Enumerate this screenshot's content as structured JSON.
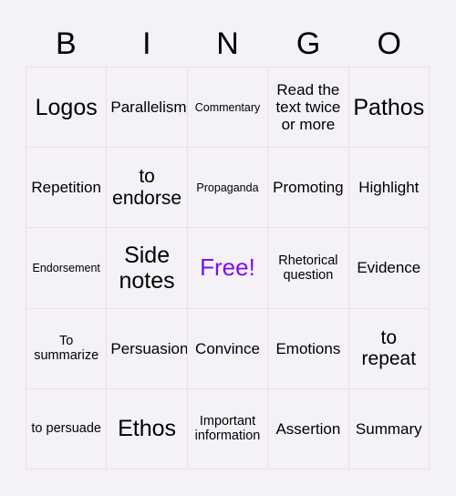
{
  "card": {
    "background_color": "#f4f2f6",
    "grid_line_color": "#ebdcf7",
    "text_color": "#000000",
    "free_space_color": "#7d0ff0"
  },
  "header": {
    "letters": [
      {
        "label": "B"
      },
      {
        "label": "I"
      },
      {
        "label": "N"
      },
      {
        "label": "G"
      },
      {
        "label": "O"
      }
    ]
  },
  "grid": {
    "columns": 5,
    "rows": 5,
    "cells": [
      {
        "text": "Logos",
        "size": "xl",
        "free": false
      },
      {
        "text": "Parallelism",
        "size": "md",
        "free": false
      },
      {
        "text": "Commentary",
        "size": "xs",
        "free": false
      },
      {
        "text": "Read the text twice or more",
        "size": "md",
        "free": false
      },
      {
        "text": "Pathos",
        "size": "xl",
        "free": false
      },
      {
        "text": "Repetition",
        "size": "md",
        "free": false
      },
      {
        "text": "to endorse",
        "size": "lg",
        "free": false
      },
      {
        "text": "Propaganda",
        "size": "xs",
        "free": false
      },
      {
        "text": "Promoting",
        "size": "md",
        "free": false
      },
      {
        "text": "Highlight",
        "size": "md",
        "free": false
      },
      {
        "text": "Endorsement",
        "size": "xs",
        "free": false
      },
      {
        "text": "Side notes",
        "size": "xl",
        "free": false
      },
      {
        "text": "Free!",
        "size": "xl",
        "free": true
      },
      {
        "text": "Rhetorical question",
        "size": "sm",
        "free": false
      },
      {
        "text": "Evidence",
        "size": "md",
        "free": false
      },
      {
        "text": "To summarize",
        "size": "sm",
        "free": false
      },
      {
        "text": "Persuasion",
        "size": "md",
        "free": false
      },
      {
        "text": "Convince",
        "size": "md",
        "free": false
      },
      {
        "text": "Emotions",
        "size": "md",
        "free": false
      },
      {
        "text": "to repeat",
        "size": "lg",
        "free": false
      },
      {
        "text": "to persuade",
        "size": "sm",
        "free": false
      },
      {
        "text": "Ethos",
        "size": "xl",
        "free": false
      },
      {
        "text": "Important information",
        "size": "sm",
        "free": false
      },
      {
        "text": "Assertion",
        "size": "md",
        "free": false
      },
      {
        "text": "Summary",
        "size": "md",
        "free": false
      }
    ]
  }
}
